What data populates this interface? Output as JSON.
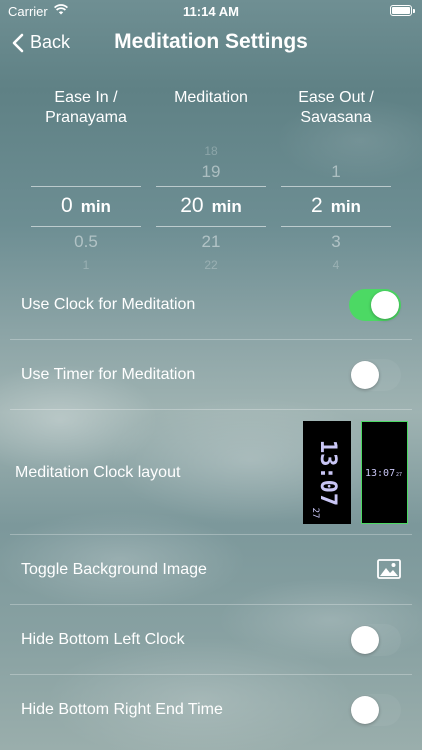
{
  "status": {
    "carrier": "Carrier",
    "time": "11:14 AM"
  },
  "nav": {
    "back_label": "Back",
    "title": "Meditation Settings"
  },
  "pickers": [
    {
      "header_line1": "Ease In /",
      "header_line2": "Pranayama",
      "above2": "",
      "above": "",
      "selected": "0",
      "unit": "min",
      "below": "0.5",
      "below2": "1"
    },
    {
      "header_line1": "Meditation",
      "header_line2": "",
      "above2": "18",
      "above": "19",
      "selected": "20",
      "unit": "min",
      "below": "21",
      "below2": "22"
    },
    {
      "header_line1": "Ease Out /",
      "header_line2": "Savasana",
      "above2": "",
      "above": "1",
      "selected": "2",
      "unit": "min",
      "below": "3",
      "below2": "4"
    }
  ],
  "settings": {
    "use_clock": {
      "label": "Use Clock for Meditation",
      "on": true
    },
    "use_timer": {
      "label": "Use Timer for Meditation",
      "on": false
    },
    "clock_layout": {
      "label": "Meditation Clock layout",
      "vertical_preview": "13:07",
      "vertical_seconds": "27",
      "horizontal_preview": "13:07",
      "horizontal_seconds": "27"
    },
    "toggle_bg": {
      "label": "Toggle Background Image",
      "icon": "image-icon"
    },
    "hide_bl_clock": {
      "label": "Hide Bottom Left Clock",
      "on": false
    },
    "hide_br_end": {
      "label": "Hide Bottom Right End Time",
      "on": false
    }
  },
  "colors": {
    "accent_green": "#4cd964"
  }
}
